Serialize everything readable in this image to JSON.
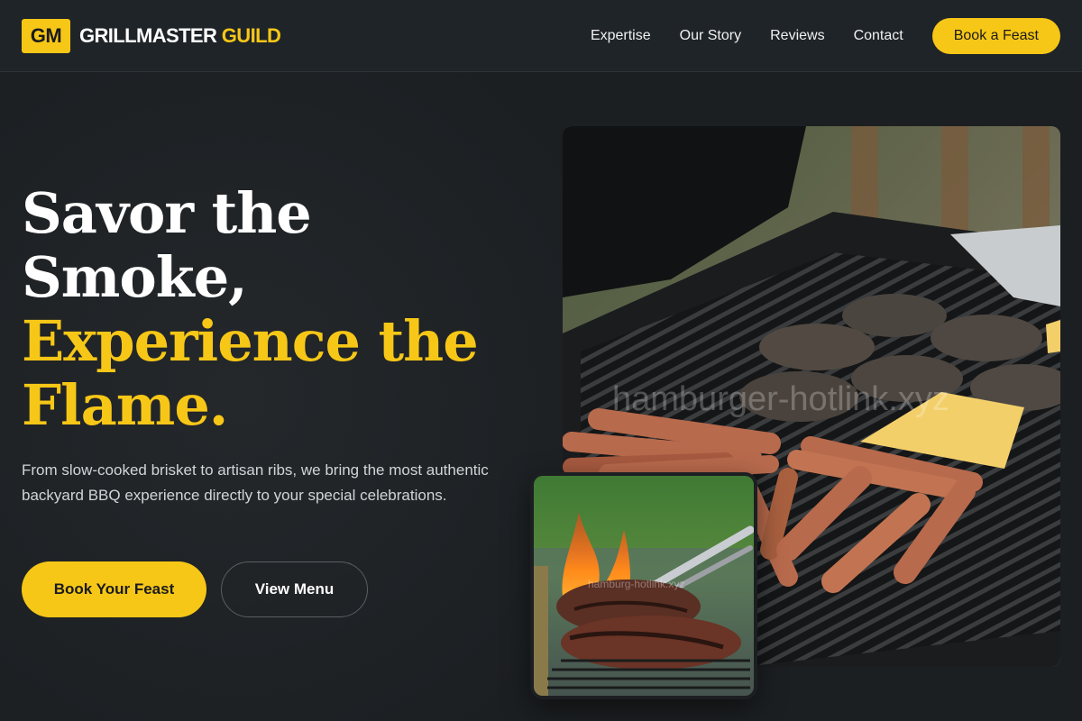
{
  "brand": {
    "badge": "GM",
    "name_main": "GRILLMASTER",
    "name_accent": "GUILD"
  },
  "nav": {
    "items": [
      {
        "label": "Expertise"
      },
      {
        "label": "Our Story"
      },
      {
        "label": "Reviews"
      },
      {
        "label": "Contact"
      }
    ],
    "cta_label": "Book a Feast"
  },
  "hero": {
    "headline_line1": "Savor the",
    "headline_line2": "Smoke,",
    "headline_line3": "Experience the",
    "headline_line4": "Flame.",
    "subtitle": "From slow-cooked brisket to artisan ribs, we bring the most authentic backyard BBQ experience directly to your special celebrations.",
    "primary_button": "Book Your Feast",
    "secondary_button": "View Menu",
    "main_photo_watermark": "hamburger-hotlink.xyz",
    "small_photo_watermark": "hamburg-hotlink.xyz"
  },
  "colors": {
    "accent": "#f7c717",
    "background": "#1c1f22",
    "header": "#1f2428"
  }
}
